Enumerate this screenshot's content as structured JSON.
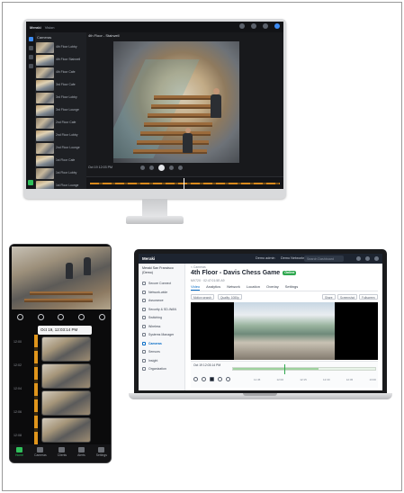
{
  "desktop": {
    "app_brand": "Meraki",
    "window_tab": "Vision",
    "camera_title": "4th Floor - Stairwell",
    "list_header": "Cameras",
    "list_items": [
      "4th Floor Lobby",
      "4th Floor Stairwell",
      "4th Floor Cafe",
      "3rd Floor Cafe",
      "3rd Floor Lobby",
      "3rd Floor Lounge",
      "2nd Floor Cafe",
      "2nd Floor Lobby",
      "2nd Floor Lounge",
      "1st Floor Cafe",
      "1st Floor Lobby",
      "1st Floor Lounge"
    ],
    "time_readout": "Oct 19 12:03 PM",
    "colors": {
      "accent": "#3d8bf2",
      "timeline": "#d98a1c",
      "status": "#2fbf5a"
    }
  },
  "phone": {
    "timestamp": "Oct 19, 12:03:14 PM",
    "axis_labels": [
      "12:00",
      "12:02",
      "12:04",
      "12:06",
      "12:08"
    ],
    "nav": [
      "Home",
      "Cameras",
      "Clients",
      "Alerts",
      "Settings"
    ],
    "nav_active": "Home"
  },
  "laptop": {
    "brand": "Meraki",
    "org_selector": "Demo admin",
    "network_selector": "Demo Networks",
    "search_placeholder": "Search Dashboard",
    "side_org": "Meraki San Francisco (Demo)",
    "side_items": [
      "Secure Connect",
      "Network-wide",
      "Assurance",
      "Security & SD-WAN",
      "Switching",
      "Wireless",
      "Systems Manager",
      "Cameras",
      "Sensors",
      "Insight",
      "Organization"
    ],
    "side_active": "Cameras",
    "breadcrumb": "< Cameras",
    "camera_title": "4th Floor - Davis Chess Game",
    "status_badge": "Online",
    "subtitle": "MV72X · 02:47:01:5E:A9",
    "tabs": [
      "Video",
      "Analytics",
      "Network",
      "Location",
      "Overlay",
      "Settings"
    ],
    "tab_active": "Video",
    "toolbar_left": [
      "Motion search",
      "Quality: 1080p"
    ],
    "toolbar_right": [
      "Share",
      "Screenshot",
      "Fullscreen"
    ],
    "timeline_date": "Oct 19 12:03:14 PM",
    "timeline_ticks": [
      "11:45",
      "12:00",
      "12:15",
      "12:30",
      "12:45",
      "13:00"
    ]
  }
}
